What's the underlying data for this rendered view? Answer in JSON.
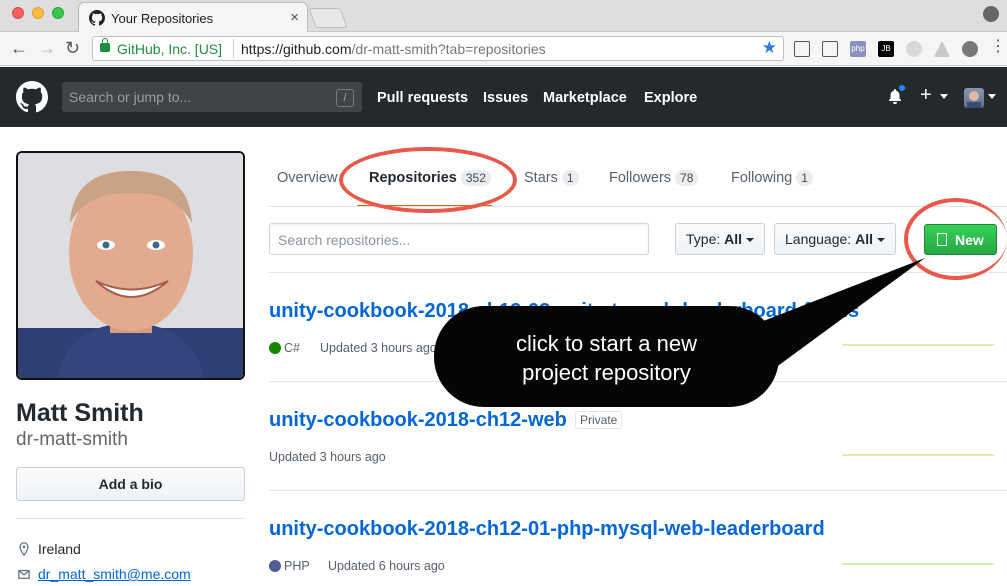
{
  "browser": {
    "tab_title": "Your Repositories",
    "tab_close": "×",
    "secure_label": "GitHub, Inc. [US]",
    "url_main": "https://github.com",
    "url_rest": "/dr-matt-smith?tab=repositories",
    "star": "★",
    "ext_labels": [
      "php",
      "JB"
    ]
  },
  "header": {
    "search_placeholder": "Search or jump to...",
    "search_shortcut": "/",
    "nav": [
      "Pull requests",
      "Issues",
      "Marketplace",
      "Explore"
    ],
    "plus": "+"
  },
  "profile": {
    "full_name": "Matt Smith",
    "username": "dr-matt-smith",
    "bio_button": "Add a bio",
    "location": "Ireland",
    "email": "dr_matt_smith@me.com"
  },
  "tabs": [
    {
      "label": "Overview",
      "count": null
    },
    {
      "label": "Repositories",
      "count": "352"
    },
    {
      "label": "Stars",
      "count": "1"
    },
    {
      "label": "Followers",
      "count": "78"
    },
    {
      "label": "Following",
      "count": "1"
    }
  ],
  "filters": {
    "search_placeholder": "Search repositories...",
    "type_label": "Type:",
    "type_value": "All",
    "language_label": "Language:",
    "language_value": "All",
    "new_button": "New"
  },
  "repos": [
    {
      "name": "unity-cookbook-2018-ch12-03-unity-to-web-leaderboard-forms",
      "language": "C#",
      "lang_color": "#178600",
      "updated": "Updated 3 hours ago",
      "badge": null
    },
    {
      "name": "unity-cookbook-2018-ch12-web",
      "language": null,
      "lang_color": null,
      "updated": "Updated 3 hours ago",
      "badge": "Private"
    },
    {
      "name": "unity-cookbook-2018-ch12-01-php-mysql-web-leaderboard",
      "language": "PHP",
      "lang_color": "#4F5D95",
      "updated": "Updated 6 hours ago",
      "badge": null
    }
  ],
  "annotation": {
    "line1": "click to start a new",
    "line2": "project repository",
    "color": "#e8584b"
  }
}
